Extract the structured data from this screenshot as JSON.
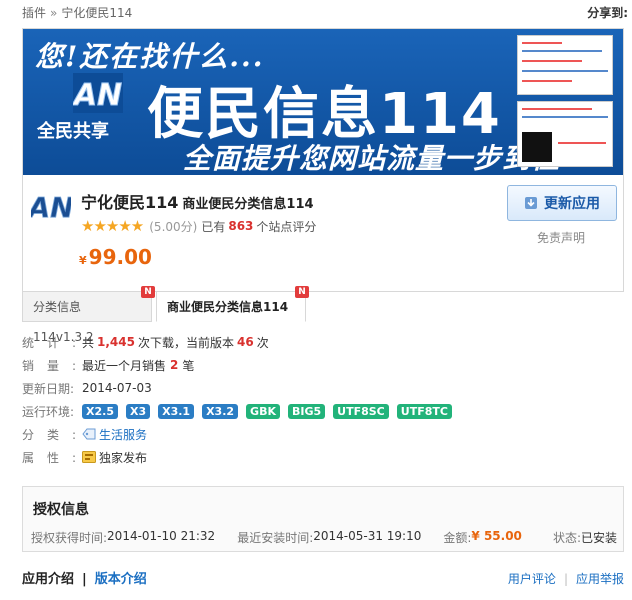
{
  "breadcrumb": {
    "root": "插件",
    "separator": "»",
    "current": "宁化便民114"
  },
  "share_label": "分享到:",
  "banner": {
    "slogan": "您!还在找什么...",
    "logo_text": "AN",
    "share_text": "全民共享",
    "big_title": "便民信息114",
    "sub_slogan": "全面提升您网站流量一步到位"
  },
  "app": {
    "logo_text": "AN",
    "name": "宁化便民114",
    "subtitle": "商业便民分类信息114",
    "stars": "★★★★★",
    "score": "(5.00分)",
    "rating_prefix": "已有",
    "rating_count": "863",
    "rating_suffix": "个站点评分",
    "currency": "¥",
    "price": "99.00",
    "update_button": "更新应用",
    "disclaimer": "免责声明"
  },
  "tabs": [
    {
      "label": "分类信息114v1.3.2",
      "badge": "N"
    },
    {
      "label": "商业便民分类信息114",
      "badge": "N"
    }
  ],
  "meta": {
    "stats_label": "统计:",
    "stats_prefix": "共",
    "downloads": "1,445",
    "stats_mid": "次下载，当前版本",
    "version_downloads": "46",
    "stats_suffix": "次",
    "sales_label": "销量:",
    "sales_prefix": "最近一个月销售",
    "sales_count": "2",
    "sales_suffix": "笔",
    "date_label": "更新日期:",
    "date_value": "2014-07-03",
    "env_label": "运行环境:",
    "env_blue": [
      "X2.5",
      "X3",
      "X3.1",
      "X3.2"
    ],
    "env_green": [
      "GBK",
      "BIG5",
      "UTF8SC",
      "UTF8TC"
    ],
    "category_label": "分类:",
    "category_value": "生活服务",
    "attribute_label": "属性:",
    "attribute_value": "独家发布"
  },
  "auth": {
    "title": "授权信息",
    "obtained_label": "授权获得时间:",
    "obtained_value": "2014-01-10 21:32",
    "installed_label": "最近安装时间:",
    "installed_value": "2014-05-31 19:10",
    "amount_label": "金额:",
    "amount_value": "¥ 55.00",
    "status_label": "状态:",
    "status_value": "已安装"
  },
  "bottom": {
    "tab_intro": "应用介绍",
    "tab_version": "版本介绍",
    "user_reviews": "用户评论",
    "report": "应用举报"
  },
  "colors": {
    "banner_blue": "#1257a6",
    "price_orange": "#e8650d",
    "count_red": "#d9312e",
    "link_blue": "#1b6fc2",
    "env_blue": "#2b7dc4",
    "env_green": "#22b37a"
  }
}
